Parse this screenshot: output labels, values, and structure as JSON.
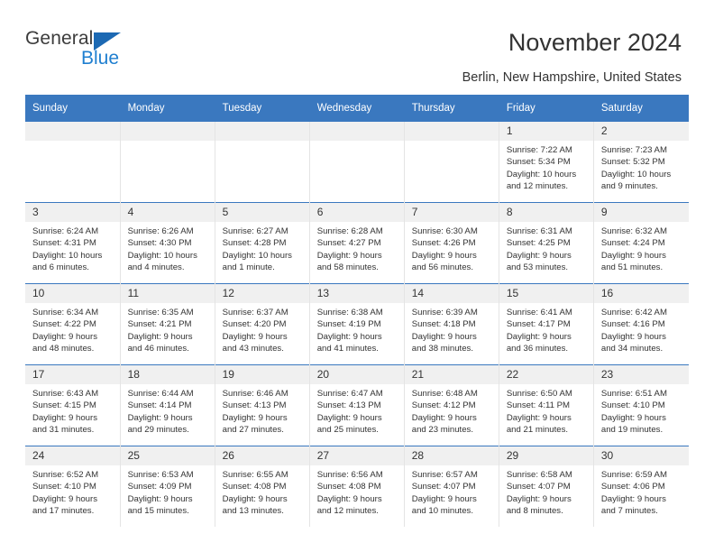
{
  "brand": {
    "name_top": "General",
    "name_bottom": "Blue",
    "triangle_color": "#1c69b3",
    "text_color": "#3c3c3c",
    "blue_text_color": "#1f7fd0"
  },
  "header": {
    "title": "November 2024",
    "subtitle": "Berlin, New Hampshire, United States",
    "header_bg": "#3a78bf",
    "daynum_bg": "#f0f0f0"
  },
  "weekdays": [
    "Sunday",
    "Monday",
    "Tuesday",
    "Wednesday",
    "Thursday",
    "Friday",
    "Saturday"
  ],
  "labels": {
    "sunrise": "Sunrise:",
    "sunset": "Sunset:",
    "daylight": "Daylight:"
  },
  "weeks": [
    [
      {
        "day": "",
        "blank": true
      },
      {
        "day": "",
        "blank": true
      },
      {
        "day": "",
        "blank": true
      },
      {
        "day": "",
        "blank": true
      },
      {
        "day": "",
        "blank": true
      },
      {
        "day": "1",
        "sunrise": "Sunrise: 7:22 AM",
        "sunset": "Sunset: 5:34 PM",
        "daylight1": "Daylight: 10 hours",
        "daylight2": "and 12 minutes."
      },
      {
        "day": "2",
        "sunrise": "Sunrise: 7:23 AM",
        "sunset": "Sunset: 5:32 PM",
        "daylight1": "Daylight: 10 hours",
        "daylight2": "and 9 minutes."
      }
    ],
    [
      {
        "day": "3",
        "sunrise": "Sunrise: 6:24 AM",
        "sunset": "Sunset: 4:31 PM",
        "daylight1": "Daylight: 10 hours",
        "daylight2": "and 6 minutes."
      },
      {
        "day": "4",
        "sunrise": "Sunrise: 6:26 AM",
        "sunset": "Sunset: 4:30 PM",
        "daylight1": "Daylight: 10 hours",
        "daylight2": "and 4 minutes."
      },
      {
        "day": "5",
        "sunrise": "Sunrise: 6:27 AM",
        "sunset": "Sunset: 4:28 PM",
        "daylight1": "Daylight: 10 hours",
        "daylight2": "and 1 minute."
      },
      {
        "day": "6",
        "sunrise": "Sunrise: 6:28 AM",
        "sunset": "Sunset: 4:27 PM",
        "daylight1": "Daylight: 9 hours",
        "daylight2": "and 58 minutes."
      },
      {
        "day": "7",
        "sunrise": "Sunrise: 6:30 AM",
        "sunset": "Sunset: 4:26 PM",
        "daylight1": "Daylight: 9 hours",
        "daylight2": "and 56 minutes."
      },
      {
        "day": "8",
        "sunrise": "Sunrise: 6:31 AM",
        "sunset": "Sunset: 4:25 PM",
        "daylight1": "Daylight: 9 hours",
        "daylight2": "and 53 minutes."
      },
      {
        "day": "9",
        "sunrise": "Sunrise: 6:32 AM",
        "sunset": "Sunset: 4:24 PM",
        "daylight1": "Daylight: 9 hours",
        "daylight2": "and 51 minutes."
      }
    ],
    [
      {
        "day": "10",
        "sunrise": "Sunrise: 6:34 AM",
        "sunset": "Sunset: 4:22 PM",
        "daylight1": "Daylight: 9 hours",
        "daylight2": "and 48 minutes."
      },
      {
        "day": "11",
        "sunrise": "Sunrise: 6:35 AM",
        "sunset": "Sunset: 4:21 PM",
        "daylight1": "Daylight: 9 hours",
        "daylight2": "and 46 minutes."
      },
      {
        "day": "12",
        "sunrise": "Sunrise: 6:37 AM",
        "sunset": "Sunset: 4:20 PM",
        "daylight1": "Daylight: 9 hours",
        "daylight2": "and 43 minutes."
      },
      {
        "day": "13",
        "sunrise": "Sunrise: 6:38 AM",
        "sunset": "Sunset: 4:19 PM",
        "daylight1": "Daylight: 9 hours",
        "daylight2": "and 41 minutes."
      },
      {
        "day": "14",
        "sunrise": "Sunrise: 6:39 AM",
        "sunset": "Sunset: 4:18 PM",
        "daylight1": "Daylight: 9 hours",
        "daylight2": "and 38 minutes."
      },
      {
        "day": "15",
        "sunrise": "Sunrise: 6:41 AM",
        "sunset": "Sunset: 4:17 PM",
        "daylight1": "Daylight: 9 hours",
        "daylight2": "and 36 minutes."
      },
      {
        "day": "16",
        "sunrise": "Sunrise: 6:42 AM",
        "sunset": "Sunset: 4:16 PM",
        "daylight1": "Daylight: 9 hours",
        "daylight2": "and 34 minutes."
      }
    ],
    [
      {
        "day": "17",
        "sunrise": "Sunrise: 6:43 AM",
        "sunset": "Sunset: 4:15 PM",
        "daylight1": "Daylight: 9 hours",
        "daylight2": "and 31 minutes."
      },
      {
        "day": "18",
        "sunrise": "Sunrise: 6:44 AM",
        "sunset": "Sunset: 4:14 PM",
        "daylight1": "Daylight: 9 hours",
        "daylight2": "and 29 minutes."
      },
      {
        "day": "19",
        "sunrise": "Sunrise: 6:46 AM",
        "sunset": "Sunset: 4:13 PM",
        "daylight1": "Daylight: 9 hours",
        "daylight2": "and 27 minutes."
      },
      {
        "day": "20",
        "sunrise": "Sunrise: 6:47 AM",
        "sunset": "Sunset: 4:13 PM",
        "daylight1": "Daylight: 9 hours",
        "daylight2": "and 25 minutes."
      },
      {
        "day": "21",
        "sunrise": "Sunrise: 6:48 AM",
        "sunset": "Sunset: 4:12 PM",
        "daylight1": "Daylight: 9 hours",
        "daylight2": "and 23 minutes."
      },
      {
        "day": "22",
        "sunrise": "Sunrise: 6:50 AM",
        "sunset": "Sunset: 4:11 PM",
        "daylight1": "Daylight: 9 hours",
        "daylight2": "and 21 minutes."
      },
      {
        "day": "23",
        "sunrise": "Sunrise: 6:51 AM",
        "sunset": "Sunset: 4:10 PM",
        "daylight1": "Daylight: 9 hours",
        "daylight2": "and 19 minutes."
      }
    ],
    [
      {
        "day": "24",
        "sunrise": "Sunrise: 6:52 AM",
        "sunset": "Sunset: 4:10 PM",
        "daylight1": "Daylight: 9 hours",
        "daylight2": "and 17 minutes."
      },
      {
        "day": "25",
        "sunrise": "Sunrise: 6:53 AM",
        "sunset": "Sunset: 4:09 PM",
        "daylight1": "Daylight: 9 hours",
        "daylight2": "and 15 minutes."
      },
      {
        "day": "26",
        "sunrise": "Sunrise: 6:55 AM",
        "sunset": "Sunset: 4:08 PM",
        "daylight1": "Daylight: 9 hours",
        "daylight2": "and 13 minutes."
      },
      {
        "day": "27",
        "sunrise": "Sunrise: 6:56 AM",
        "sunset": "Sunset: 4:08 PM",
        "daylight1": "Daylight: 9 hours",
        "daylight2": "and 12 minutes."
      },
      {
        "day": "28",
        "sunrise": "Sunrise: 6:57 AM",
        "sunset": "Sunset: 4:07 PM",
        "daylight1": "Daylight: 9 hours",
        "daylight2": "and 10 minutes."
      },
      {
        "day": "29",
        "sunrise": "Sunrise: 6:58 AM",
        "sunset": "Sunset: 4:07 PM",
        "daylight1": "Daylight: 9 hours",
        "daylight2": "and 8 minutes."
      },
      {
        "day": "30",
        "sunrise": "Sunrise: 6:59 AM",
        "sunset": "Sunset: 4:06 PM",
        "daylight1": "Daylight: 9 hours",
        "daylight2": "and 7 minutes."
      }
    ]
  ]
}
